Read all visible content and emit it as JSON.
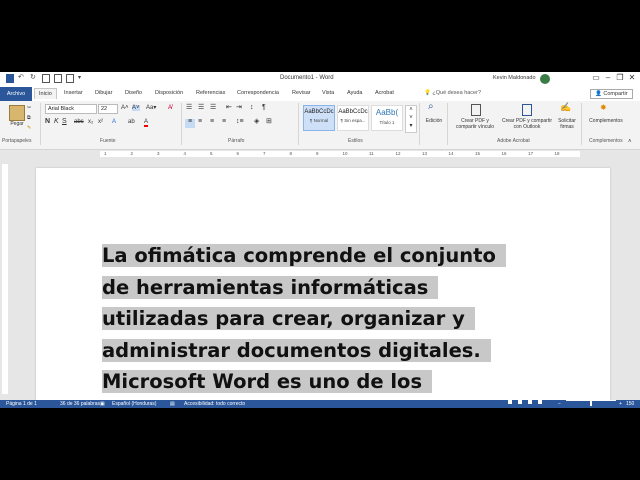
{
  "app": {
    "title": "Documento1  -  Word",
    "user": "Kevin Maldonado",
    "window_buttons": [
      "–",
      "❐",
      "✕"
    ]
  },
  "tabs": {
    "file": "Archivo",
    "items": [
      "Inicio",
      "Insertar",
      "Dibujar",
      "Diseño",
      "Disposición",
      "Referencias",
      "Correspondencia",
      "Revisar",
      "Vista",
      "Ayuda",
      "Acrobat"
    ],
    "active": "Inicio",
    "tell_me": "¿Qué desea hacer?",
    "share": "Compartir"
  },
  "ribbon": {
    "clipboard": {
      "paste": "Pegar",
      "group": "Portapapeles"
    },
    "font": {
      "name": "Arial Black",
      "size": "22",
      "group": "Fuente"
    },
    "paragraph": {
      "group": "Párrafo"
    },
    "styles": {
      "items": [
        {
          "preview": "AaBbCcDc",
          "name": "¶ Normal"
        },
        {
          "preview": "AaBbCcDc",
          "name": "¶ Sin espa..."
        },
        {
          "preview": "AaBb(",
          "name": "Título 1"
        }
      ],
      "group": "Estilos"
    },
    "editing": {
      "label": "Edición"
    },
    "acrobat": {
      "create_share": "Crear PDF y compartir vínculo",
      "create_outlook": "Crear PDF y compartir con Outlook",
      "request_sign": "Solicitar firmas",
      "group": "Adobe Acrobat"
    },
    "addins": {
      "label": "Complementos",
      "group": "Complementos"
    }
  },
  "ruler": [
    "1",
    "2",
    "3",
    "4",
    "5",
    "6",
    "7",
    "8",
    "9",
    "10",
    "11",
    "12",
    "13",
    "14",
    "15",
    "16",
    "17",
    "18"
  ],
  "document": {
    "lines": [
      "La ofimática comprende el conjunto",
      "de herramientas informáticas",
      "utilizadas para crear, organizar y",
      "administrar documentos digitales.",
      "Microsoft Word es uno de los"
    ]
  },
  "status": {
    "page": "Página 1 de 1",
    "words": "36 de 36 palabras",
    "language": "Español (Honduras)",
    "accessibility": "Accesibilidad: todo correcto",
    "zoom": "150 %"
  },
  "colors": {
    "accent": "#2b579a",
    "highlight": "#c8c8c8"
  }
}
